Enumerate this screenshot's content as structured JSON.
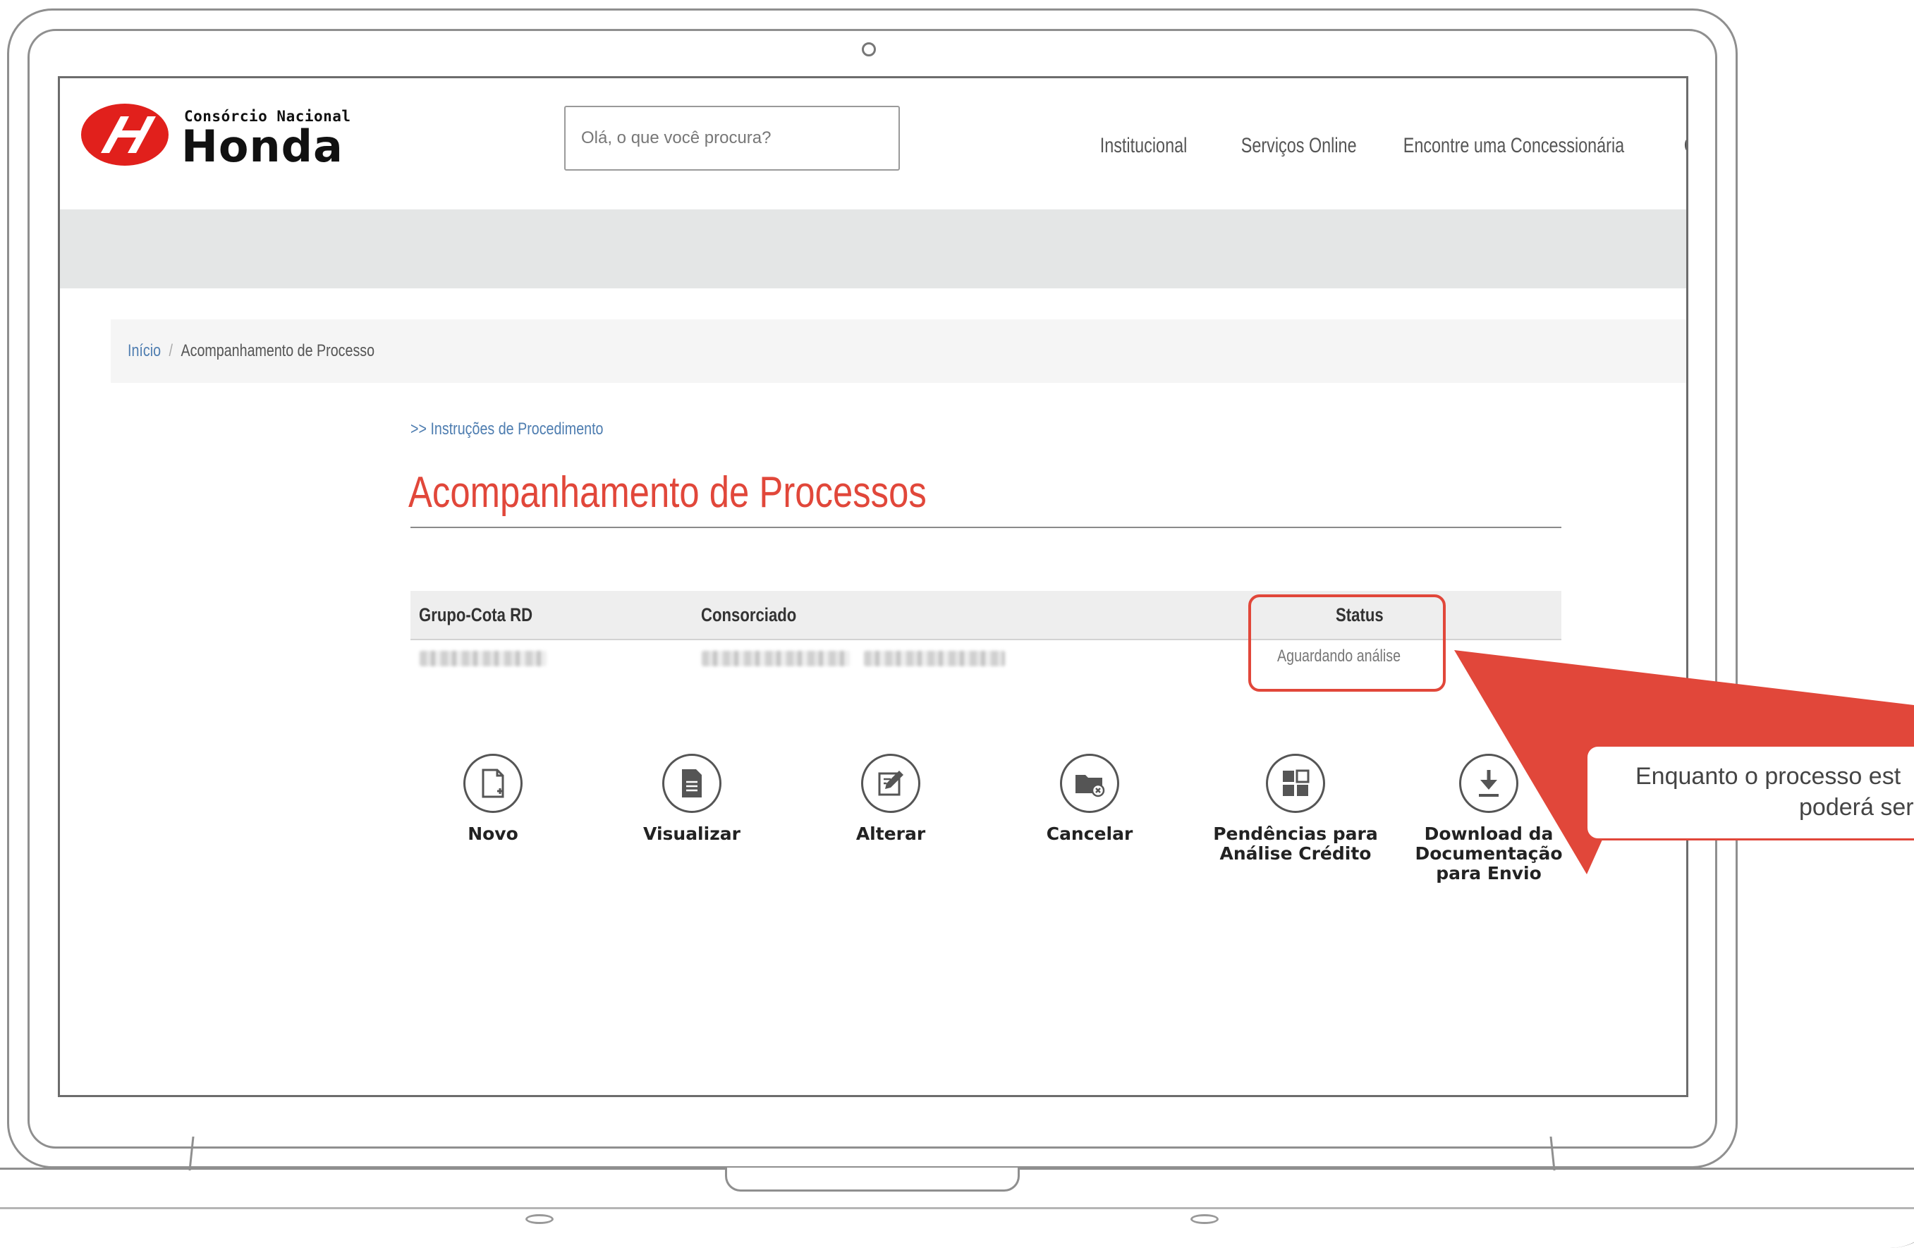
{
  "header": {
    "logo_small": "Consórcio Nacional",
    "logo_big": "Honda",
    "search_placeholder": "Olá, o que você procura?",
    "nav": [
      {
        "label": "Institucional"
      },
      {
        "label": "Serviços Online"
      },
      {
        "label": "Encontre uma Concessionária"
      },
      {
        "label": "C"
      }
    ]
  },
  "breadcrumb": {
    "home": "Início",
    "separator": "/",
    "current": "Acompanhamento de Processo"
  },
  "main": {
    "instructions_link": ">> Instruções de Procedimento",
    "title": "Acompanhamento de Processos",
    "table": {
      "headers": [
        "Grupo-Cota RD",
        "Consorciado",
        "Status"
      ],
      "row": {
        "status": "Aguardando análise"
      }
    },
    "actions": [
      {
        "label": "Novo",
        "icon": "new-document-icon"
      },
      {
        "label": "Visualizar",
        "icon": "view-document-icon"
      },
      {
        "label": "Alterar",
        "icon": "edit-icon"
      },
      {
        "label": "Cancelar",
        "icon": "cancel-folder-icon"
      },
      {
        "label": "Pendências para Análise Crédito",
        "icon": "grid-pending-icon"
      },
      {
        "label": "Download da Documentação para Envio",
        "icon": "download-icon"
      }
    ]
  },
  "annotation": {
    "callout_line1": "Enquanto o processo est",
    "callout_line2": "poderá ser a"
  },
  "colors": {
    "accent_red": "#e1473a",
    "link_blue": "#4e7db0",
    "band_gray": "#e4e6e6"
  }
}
